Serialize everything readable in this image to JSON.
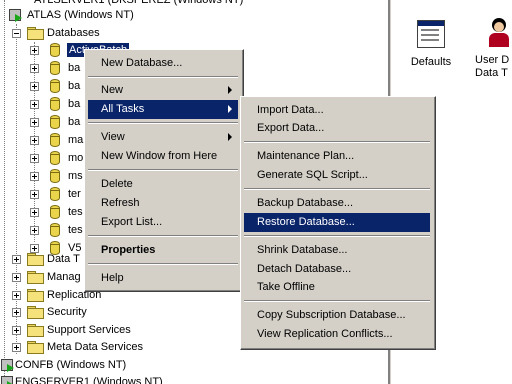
{
  "tree": {
    "top_cut": "ATLSERVER1 (DKSPEREZ (Windows NT)",
    "atlas": "ATLAS (Windows NT)",
    "databases": "Databases",
    "db_items": [
      "ActiveBatch",
      "ba",
      "ba",
      "ba",
      "ba",
      "ma",
      "mo",
      "ms",
      "ter",
      "tes",
      "tes",
      "V5"
    ],
    "folders_below": [
      "Data T",
      "Manag",
      "Replication",
      "Security",
      "Support Services",
      "Meta Data Services"
    ],
    "confb": "CONFB (Windows NT)",
    "bottom_cut": "ENGSERVER1 (Windows NT)"
  },
  "right_panel": {
    "items": [
      {
        "label": "Defaults",
        "icon": "defaults-icon"
      },
      {
        "label": "User D Data T",
        "icon": "user-icon"
      }
    ]
  },
  "context_menu": {
    "items": [
      "New Database...",
      "New",
      "All Tasks",
      "View",
      "New Window from Here",
      "Delete",
      "Refresh",
      "Export List...",
      "Properties",
      "Help"
    ]
  },
  "submenu": {
    "items": [
      "Import Data...",
      "Export Data...",
      "Maintenance Plan...",
      "Generate SQL Script...",
      "Backup Database...",
      "Restore Database...",
      "Shrink Database...",
      "Detach Database...",
      "Take Offline",
      "Copy Subscription Database...",
      "View Replication Conflicts..."
    ]
  },
  "colors": {
    "highlight": "#0a246a",
    "menu_bg": "#d4d0c8"
  }
}
